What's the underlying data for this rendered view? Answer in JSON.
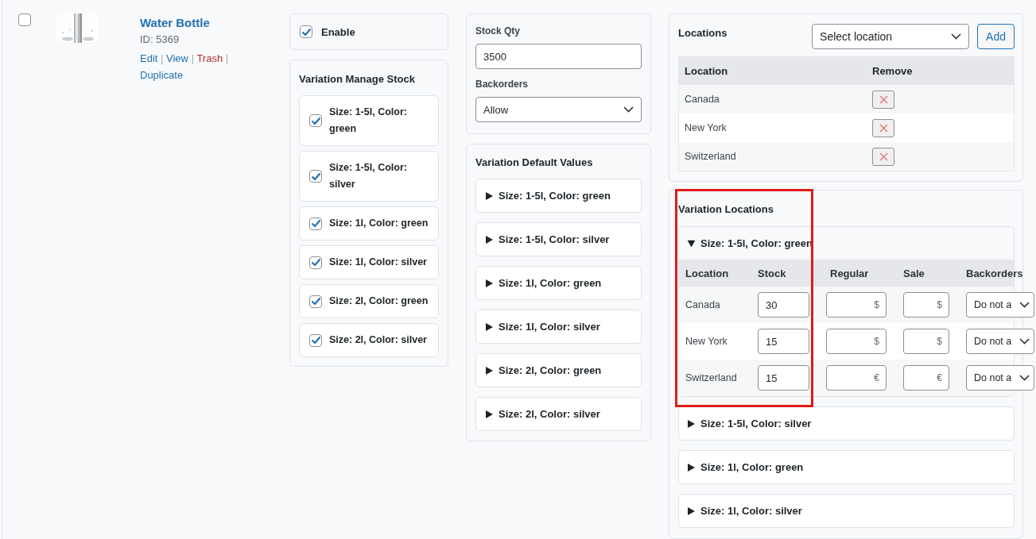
{
  "product": {
    "checked": false,
    "name": "Water Bottle",
    "id": "ID: 5369",
    "separator": "|",
    "actions": [
      {
        "label": "Edit",
        "kind": "normal"
      },
      {
        "label": "View",
        "kind": "normal"
      },
      {
        "label": "Trash",
        "kind": "danger"
      },
      {
        "label": "Duplicate",
        "kind": "normal"
      }
    ]
  },
  "enable": {
    "label": "Enable",
    "checked": true
  },
  "manage_stock": {
    "title": "Variation Manage Stock",
    "items": [
      {
        "label": "Size: 1-5l, Color: green",
        "checked": true
      },
      {
        "label": "Size: 1-5l, Color: silver",
        "checked": true
      },
      {
        "label": "Size: 1l, Color: green",
        "checked": true
      },
      {
        "label": "Size: 1l, Color: silver",
        "checked": true
      },
      {
        "label": "Size: 2l, Color: green",
        "checked": true
      },
      {
        "label": "Size: 2l, Color: silver",
        "checked": true
      }
    ]
  },
  "stock": {
    "qty_label": "Stock Qty",
    "qty_value": "3500",
    "backorders_label": "Backorders",
    "backorders_value": "Allow"
  },
  "default_values": {
    "title": "Variation Default Values",
    "items": [
      {
        "label": "Size: 1-5l, Color: green",
        "expanded": false
      },
      {
        "label": "Size: 1-5l, Color: silver",
        "expanded": false
      },
      {
        "label": "Size: 1l, Color: green",
        "expanded": false
      },
      {
        "label": "Size: 1l, Color: silver",
        "expanded": false
      },
      {
        "label": "Size: 2l, Color: green",
        "expanded": false
      },
      {
        "label": "Size: 2l, Color: silver",
        "expanded": false
      }
    ]
  },
  "locations": {
    "title": "Locations",
    "select_placeholder": "Select location",
    "add_button": "Add",
    "columns": [
      "Location",
      "Remove"
    ],
    "rows": [
      {
        "location": "Canada"
      },
      {
        "location": "New York"
      },
      {
        "location": "Switzerland"
      }
    ]
  },
  "variation_locations": {
    "title": "Variation Locations",
    "highlight": true,
    "items": [
      {
        "label": "Size: 1-5l, Color: green",
        "expanded": true,
        "columns": [
          "Location",
          "Stock",
          "Regular",
          "Sale",
          "Backorders"
        ],
        "rows": [
          {
            "location": "Canada",
            "stock": "30",
            "regular_currency": "$",
            "sale_currency": "$",
            "backorders": "Do not a"
          },
          {
            "location": "New York",
            "stock": "15",
            "regular_currency": "$",
            "sale_currency": "$",
            "backorders": "Do not a"
          },
          {
            "location": "Switzerland",
            "stock": "15",
            "regular_currency": "€",
            "sale_currency": "€",
            "backorders": "Do not a"
          }
        ]
      },
      {
        "label": "Size: 1-5l, Color: silver",
        "expanded": false
      },
      {
        "label": "Size: 1l, Color: green",
        "expanded": false
      },
      {
        "label": "Size: 1l, Color: silver",
        "expanded": false
      }
    ]
  }
}
